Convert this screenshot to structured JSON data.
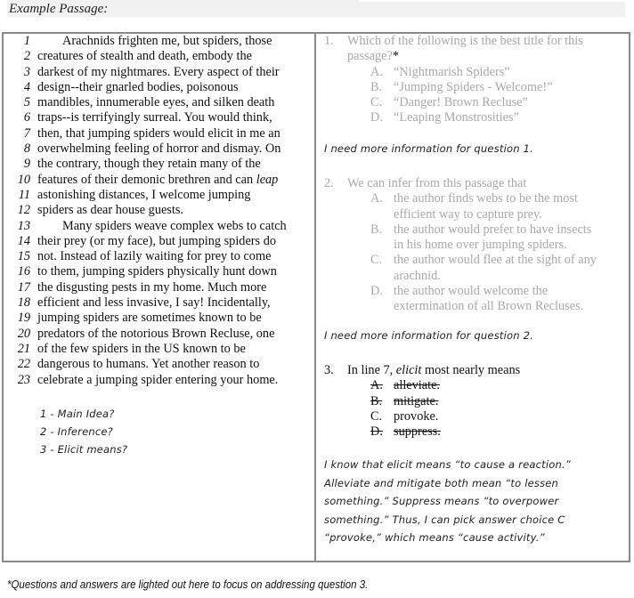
{
  "header": {
    "title": "Example Passage:"
  },
  "passage": {
    "lines": [
      {
        "n": "1",
        "text": "Arachnids frighten me, but spiders, those",
        "indent": true
      },
      {
        "n": "2",
        "text": "creatures of stealth and death, embody the"
      },
      {
        "n": "3",
        "text": "darkest of my nightmares.  Every aspect of their"
      },
      {
        "n": "4",
        "text": "design--their gnarled bodies, poisonous"
      },
      {
        "n": "5",
        "text": "mandibles, innumerable eyes, and silken death"
      },
      {
        "n": "6",
        "text": "traps--is terrifyingly surreal.  You would think,"
      },
      {
        "n": "7",
        "text": "then, that jumping spiders would elicit in me an"
      },
      {
        "n": "8",
        "text": "overwhelming feeling of horror and dismay.  On"
      },
      {
        "n": "9",
        "text": "the contrary, though they retain many of the"
      },
      {
        "n": "10",
        "text": "features of their demonic brethren and can ",
        "italic_tail": "leap"
      },
      {
        "n": "11",
        "text": "astonishing distances, I welcome jumping"
      },
      {
        "n": "12",
        "text": "spiders as dear house guests."
      },
      {
        "n": "13",
        "text": "Many spiders weave complex webs to catch",
        "indent": true
      },
      {
        "n": "14",
        "text": "their prey (or my face), but jumping spiders do"
      },
      {
        "n": "15",
        "text": "not.  Instead of lazily waiting for prey to come"
      },
      {
        "n": "16",
        "text": "to them, jumping spiders physically hunt down"
      },
      {
        "n": "17",
        "text": "the disgusting pests in my home.  Much more"
      },
      {
        "n": "18",
        "text": "efficient and less invasive, I say!  Incidentally,"
      },
      {
        "n": "19",
        "text": "jumping spiders are sometimes known to be"
      },
      {
        "n": "20",
        "text": "predators of the notorious Brown Recluse, one"
      },
      {
        "n": "21",
        "text": "of the few spiders in the US known to be"
      },
      {
        "n": "22",
        "text": "dangerous to humans.   Yet another reason to"
      },
      {
        "n": "23",
        "text": "celebrate a jumping spider entering your home."
      }
    ]
  },
  "notes": [
    "1 - Main Idea?",
    "2 - Inference?",
    "3 - Elicit means?"
  ],
  "questions": [
    {
      "num": "1.",
      "stem_lines": [
        "Which of the following is the best title for this",
        "passage?"
      ],
      "marker": "*",
      "options": [
        {
          "letter": "A.",
          "text": "“Nightmarish Spiders”"
        },
        {
          "letter": "B.",
          "text": "“Jumping Spiders - Welcome!”"
        },
        {
          "letter": "C.",
          "text": "“Danger!  Brown Recluse”"
        },
        {
          "letter": "D.",
          "text": "“Leaping Monstrosities”"
        }
      ],
      "note": "I need more information for question 1."
    },
    {
      "num": "2.",
      "stem_lines": [
        "We can infer from this passage that"
      ],
      "options": [
        {
          "letter": "A.",
          "lines": [
            "the author finds webs to be the most",
            "efficient way to capture prey."
          ]
        },
        {
          "letter": "B.",
          "lines": [
            "the author would prefer to have insects",
            "in his home over jumping spiders."
          ]
        },
        {
          "letter": "C.",
          "lines": [
            "the author would flee at the sight of any",
            "arachnid."
          ]
        },
        {
          "letter": "D.",
          "lines": [
            "the author would welcome the",
            "extermination of all Brown Recluses."
          ]
        }
      ],
      "note": "I need more information for question 2."
    },
    {
      "num": "3.",
      "stem_pre": "In line 7, ",
      "stem_italic": "elicit",
      "stem_post": " most nearly means",
      "options": [
        {
          "letter": "A.",
          "text": "alleviate.",
          "struck": true
        },
        {
          "letter": "B.",
          "text": "mitigate.",
          "struck": true
        },
        {
          "letter": "C.",
          "text": "provoke.",
          "struck": false
        },
        {
          "letter": "D.",
          "text": "suppress.",
          "struck": true
        }
      ],
      "explanation": [
        "I know that elicit means “to cause a reaction.”",
        "Alleviate and mitigate both mean “to lessen",
        "something.”  Suppress means “to overpower",
        "something.”  Thus, I can pick answer choice C",
        "“provoke,” which means “cause activity.”"
      ]
    }
  ],
  "footnote": "*Questions and answers are lighted out here to focus on addressing question 3."
}
